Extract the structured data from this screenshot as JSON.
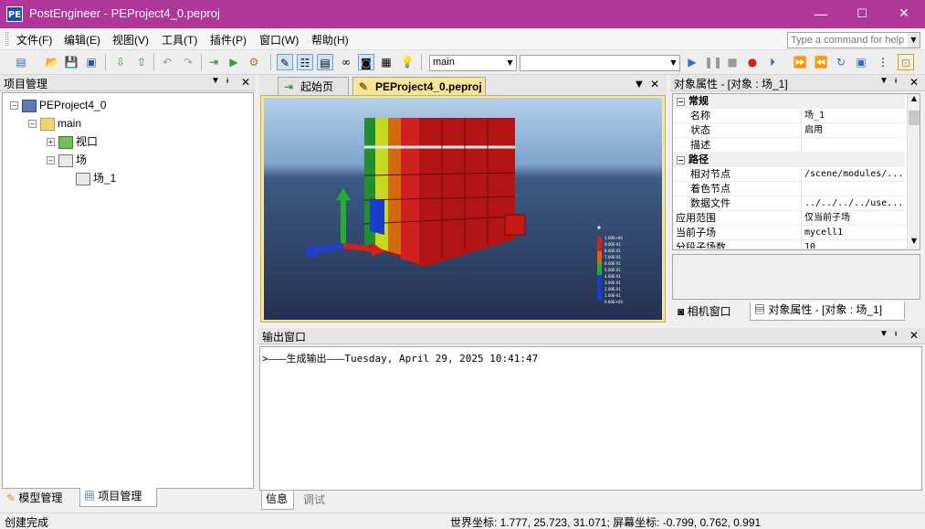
{
  "app": {
    "title": "PostEngineer - PEProject4_0.peproj",
    "icon_text": "PE"
  },
  "window_controls": {
    "minimize": "—",
    "maximize": "☐",
    "close": "✕"
  },
  "menu": [
    {
      "label": "文件(F)"
    },
    {
      "label": "编辑(E)"
    },
    {
      "label": "视图(V)"
    },
    {
      "label": "工具(T)"
    },
    {
      "label": "插件(P)"
    },
    {
      "label": "窗口(W)"
    },
    {
      "label": "帮助(H)"
    }
  ],
  "command_box": {
    "placeholder": "Type a command for help"
  },
  "toolbar": {
    "scene_combo_value": "main"
  },
  "project_panel": {
    "title": "项目管理",
    "tree": [
      {
        "label": "PEProject4_0"
      },
      {
        "label": "main"
      },
      {
        "label": "视口"
      },
      {
        "label": "场"
      },
      {
        "label": "场_1"
      }
    ],
    "bottom_tabs": [
      {
        "label": "模型管理"
      },
      {
        "label": "项目管理"
      }
    ]
  },
  "document_tabs": [
    {
      "label": "起始页"
    },
    {
      "label": "PEProject4_0.peproj"
    }
  ],
  "viewport": {
    "legend_labels": [
      "1.00E+00",
      "9.00E-01",
      "8.00E-01",
      "7.00E-01",
      "6.00E-01",
      "5.00E-01",
      "4.00E-01",
      "3.00E-01",
      "2.00E-01",
      "1.00E-01",
      "0.00E+00"
    ]
  },
  "properties_panel": {
    "title": "对象属性 - [对象 : 场_1]",
    "categories": [
      {
        "label": "常规"
      },
      {
        "label": "路径"
      }
    ],
    "rows": [
      {
        "name": "名称",
        "value": "场_1"
      },
      {
        "name": "状态",
        "value": "启用"
      },
      {
        "name": "描述",
        "value": ""
      },
      {
        "name": "相对节点",
        "value": "/scene/modules/..."
      },
      {
        "name": "着色节点",
        "value": ""
      },
      {
        "name": "数据文件",
        "value": "../../../../use..."
      },
      {
        "name": "应用范围",
        "value": "仅当前子场"
      },
      {
        "name": "当前子场",
        "value": "mycell1"
      },
      {
        "name": "分段子场数",
        "value": "10"
      }
    ],
    "bottom_tabs": [
      {
        "label": "相机窗口"
      },
      {
        "label": "对象属性 - [对象 : 场_1]"
      }
    ]
  },
  "output_panel": {
    "title": "输出窗口",
    "lines": [
      ">———生成输出———Tuesday, April 29, 2025 10:41:47"
    ],
    "bottom_tabs": [
      {
        "label": "信息"
      },
      {
        "label": "调试"
      }
    ]
  },
  "statusbar": {
    "left": "创建完成",
    "right": "世界坐标: 1.777, 25.723, 31.071;  屏幕坐标: -0.799, 0.762, 0.991"
  },
  "colors": {
    "titlebar": "#b0379a",
    "accent_tab": "#f7e59a",
    "sky_top": "#a9c7e3",
    "ground": "#2c3d5c"
  }
}
